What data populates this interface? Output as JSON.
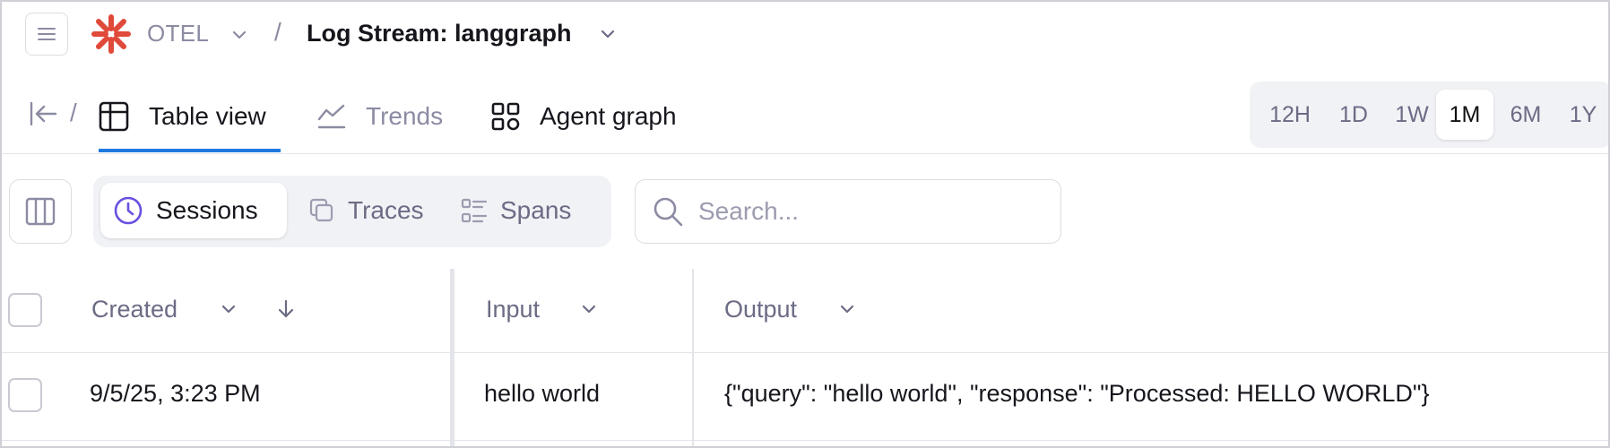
{
  "topbar": {
    "project": "OTEL",
    "stream": "Log Stream: langgraph",
    "separator": "/"
  },
  "nav": {
    "separator": "/",
    "tabs": [
      {
        "label": "Table view",
        "icon": "table-icon",
        "active": true
      },
      {
        "label": "Trends",
        "icon": "trend-icon",
        "active": false
      },
      {
        "label": "Agent graph",
        "icon": "grid-icon",
        "active": false
      }
    ],
    "active_color": "#1f7ae0"
  },
  "time_range": {
    "options": [
      "12H",
      "1D",
      "1W",
      "1M",
      "6M",
      "1Y"
    ],
    "selected": "1M"
  },
  "toolbar": {
    "view_modes": [
      {
        "label": "Sessions",
        "icon": "clock-icon",
        "active": true
      },
      {
        "label": "Traces",
        "icon": "copy-icon",
        "active": false
      },
      {
        "label": "Spans",
        "icon": "list-icon",
        "active": false
      }
    ],
    "search_placeholder": "Search...",
    "accent_color": "#6a4fe0"
  },
  "table": {
    "columns": [
      "Created",
      "Input",
      "Output"
    ],
    "rows": [
      {
        "created": "9/5/25, 3:23 PM",
        "input": "hello world",
        "output": "{\"query\": \"hello world\", \"response\": \"Processed: HELLO WORLD\"}"
      }
    ]
  }
}
